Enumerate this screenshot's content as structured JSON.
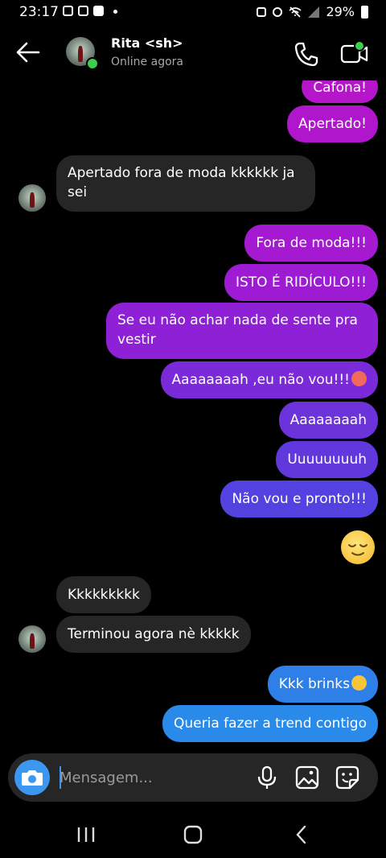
{
  "status_bar": {
    "time": "23:17",
    "battery": "29%"
  },
  "header": {
    "contact_name": "Rita <sh>",
    "status": "Online agora"
  },
  "messages": [
    {
      "text": "Cafona!",
      "side": "out",
      "color": "#b616c9"
    },
    {
      "text": "Apertado!",
      "side": "out",
      "color": "#b016cb"
    },
    {
      "text": "Apertado fora de moda kkkkkk ja sei",
      "side": "in"
    },
    {
      "text": "Fora de moda!!!",
      "side": "out",
      "color": "#a51ad0"
    },
    {
      "text": "ISTO É RIDÍCULO!!!",
      "side": "out",
      "color": "#9d1cd3"
    },
    {
      "text": "Se eu não achar nada de sente pra vestir",
      "side": "out",
      "color": "#8e20d6"
    },
    {
      "text": "Aaaaaaaah ,eu não vou!!!",
      "side": "out",
      "color": "#7b2ad9",
      "emoji": "angry-face"
    },
    {
      "text": "Aaaaaaaah",
      "side": "out",
      "color": "#6d33da"
    },
    {
      "text": "Uuuuuuuuh",
      "side": "out",
      "color": "#6038dc"
    },
    {
      "text": "Não vou e pronto!!!",
      "side": "out",
      "color": "#5342df"
    },
    {
      "text": "",
      "side": "out",
      "emoji": "relieved-face"
    },
    {
      "text": "Kkkkkkkkk",
      "side": "in"
    },
    {
      "text": "Terminou agora nè kkkkk",
      "side": "in"
    },
    {
      "text": "Kkk brinks",
      "side": "out",
      "color": "#2f7fe8",
      "emoji": "rolling-laughing-face"
    },
    {
      "text": "Queria fazer a trend contigo",
      "side": "out",
      "color": "#2a8ae9"
    }
  ],
  "composer": {
    "placeholder": "Mensagem..."
  },
  "colors": {
    "online": "#3ccf4e",
    "camera_button": "#3b97f0",
    "incoming_bubble": "#262626"
  }
}
